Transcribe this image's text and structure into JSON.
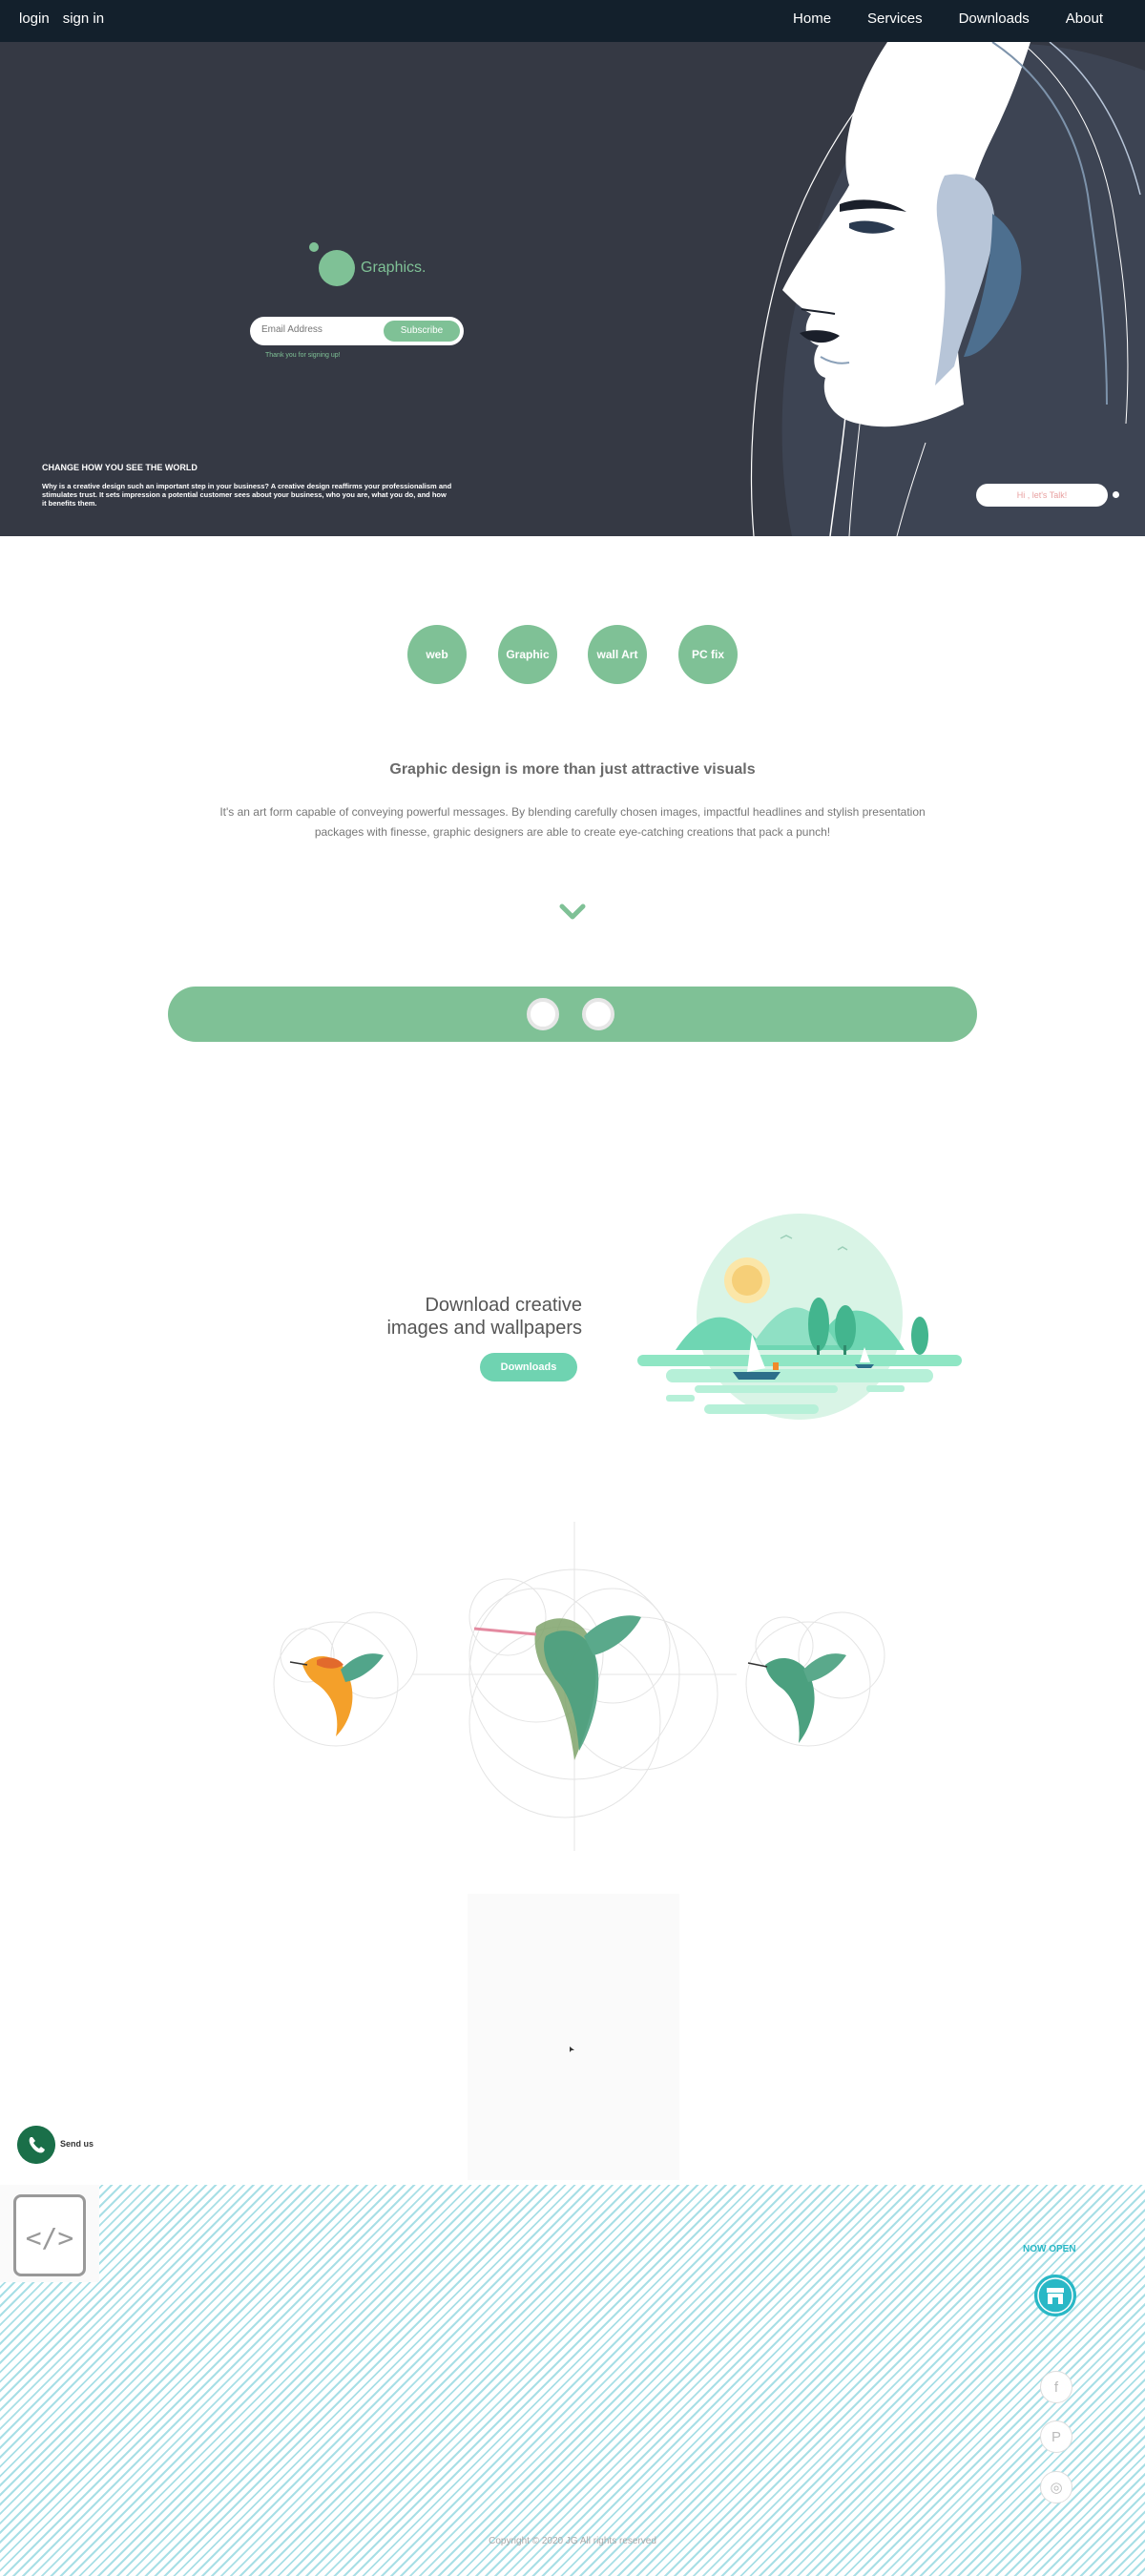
{
  "nav": {
    "login": "login",
    "signin": "sign in",
    "links": [
      "Home",
      "Services",
      "Downloads",
      "About"
    ]
  },
  "hero": {
    "logo_text": "Graphics.",
    "email_placeholder": "Email Address",
    "subscribe_label": "Subscribe",
    "thanks": "Thank you for signing up!",
    "tagline_title": "CHANGE HOW YOU SEE THE WORLD",
    "tagline_body": "Why is a creative design such an important step in your business? A creative design reaffirms your professionalism and stimulates trust. It sets impression a potential customer sees about your business, who you are, what you do, and how it benefits them.",
    "chat_label": "Hi , let's Talk!"
  },
  "categories": [
    "web",
    "Graphic",
    "wall Art",
    "PC fix"
  ],
  "intro": {
    "title": "Graphic design is more than just attractive visuals",
    "body": "It's an art form capable of conveying powerful messages. By blending carefully chosen images, impactful headlines and stylish presentation packages with finesse, graphic designers are able to create eye-catching creations that pack a punch!"
  },
  "download": {
    "line1": "Download creative",
    "line2": "images and wallpapers",
    "button": "Downloads"
  },
  "whatsapp": {
    "label": "Send us"
  },
  "footer": {
    "now_open": "NOW OPEN",
    "social": [
      "facebook-icon",
      "pinterest-icon",
      "instagram-icon"
    ],
    "copyright": "Copyright © 2020 JG All rights reserved"
  },
  "colors": {
    "nav_bg": "#13202c",
    "hero_bg": "#353944",
    "accent_green": "#7fc196",
    "accent_teal": "#29b8c6",
    "download_button": "#6fd3b1"
  }
}
